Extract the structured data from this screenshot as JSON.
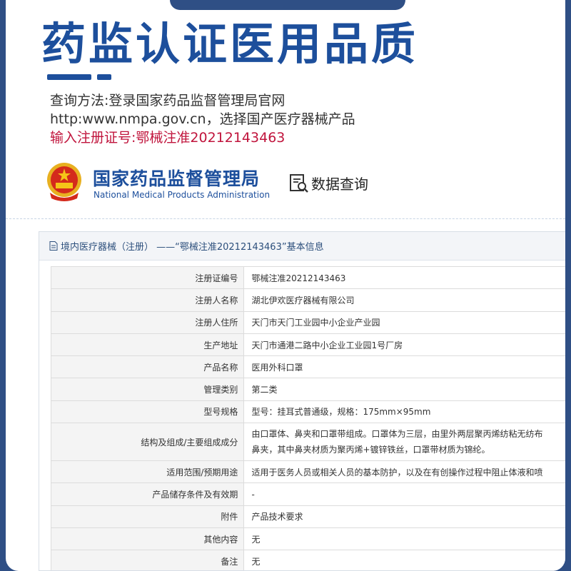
{
  "headline": "药监认证医用品质",
  "instructions": {
    "line1": "查询方法:登录国家药品监督管理局官网",
    "line2": "http:www.nmpa.gov.cn，选择国产医疗器械产品",
    "line3": "输入注册证号:鄂械注准20212143463"
  },
  "agency": {
    "name_cn": "国家药品监督管理局",
    "name_en": "National Medical Products Administration"
  },
  "query": {
    "label": "数据查询"
  },
  "panel": {
    "title": "境内医疗器械（注册） ——“鄂械注准20212143463”基本信息"
  },
  "rows": [
    {
      "key": "注册证编号",
      "value": "鄂械注准20212143463"
    },
    {
      "key": "注册人名称",
      "value": "湖北伊欢医疗器械有限公司"
    },
    {
      "key": "注册人住所",
      "value": "天门市天门工业园中小企业产业园"
    },
    {
      "key": "生产地址",
      "value": "天门市通港二路中小企业工业园1号厂房"
    },
    {
      "key": "产品名称",
      "value": "医用外科口罩"
    },
    {
      "key": "管理类别",
      "value": "第二类"
    },
    {
      "key": "型号规格",
      "value": "型号：挂耳式普通级，规格：175mm×95mm"
    },
    {
      "key": "结构及组成/主要组成成分",
      "value": "由口罩体、鼻夹和口罩带组成。口罩体为三层，由里外两层聚丙烯纺粘无纺布",
      "value2": "鼻夹，其中鼻夹材质为聚丙烯+镀锌铁丝，口罩带材质为锦纶。"
    },
    {
      "key": "适用范围/预期用途",
      "value": "适用于医务人员或相关人员的基本防护，以及在有创操作过程中阻止体液和喷"
    },
    {
      "key": "产品储存条件及有效期",
      "value": "-"
    },
    {
      "key": "附件",
      "value": "产品技术要求"
    },
    {
      "key": "其他内容",
      "value": "无"
    },
    {
      "key": "备注",
      "value": "无"
    }
  ],
  "colors": {
    "brand_blue": "#1d4f9c",
    "highlight_red": "#c0143c",
    "frame_blue": "#2f4f85"
  },
  "icons": [
    "national-emblem-icon",
    "search-document-icon",
    "document-icon"
  ]
}
